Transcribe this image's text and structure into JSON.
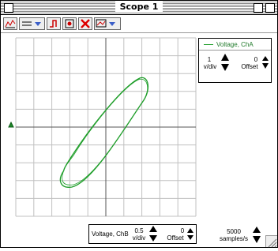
{
  "window": {
    "title": "Scope 1"
  },
  "toolbar": {
    "buttons": [
      {
        "name": "scope-display-icon"
      },
      {
        "name": "trigger-menu-icon"
      },
      {
        "name": "trigger-level-icon"
      },
      {
        "name": "cursor-icon"
      },
      {
        "name": "delete-icon"
      },
      {
        "name": "channels-menu-icon"
      }
    ]
  },
  "legend": {
    "channel_label": "Voltage, ChA",
    "scale_value": "1",
    "scale_unit": "v/div",
    "offset_value": "0",
    "offset_label": "Offset"
  },
  "bottom_control": {
    "channel_label": "Voltage, ChB",
    "scale_value": "0.5",
    "scale_unit": "v/div",
    "offset_value": "0",
    "offset_label": "Offset"
  },
  "samples": {
    "value": "5000",
    "unit": "samples/s"
  },
  "colors": {
    "trace": "#1f9e2a",
    "grid": "#b8b8b8",
    "axis": "#555555"
  }
}
